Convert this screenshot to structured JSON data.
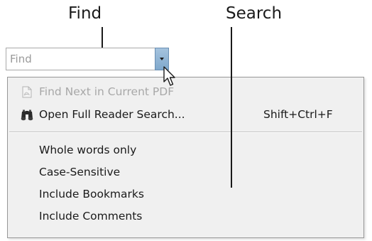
{
  "callouts": {
    "find": "Find",
    "search": "Search"
  },
  "find_box": {
    "placeholder": "Find",
    "value": ""
  },
  "menu": {
    "items": [
      {
        "label": "Find Next in Current PDF",
        "icon": "pdf-document-icon",
        "enabled": false
      },
      {
        "label": "Open Full Reader Search...",
        "icon": "binoculars-icon",
        "shortcut": "Shift+Ctrl+F",
        "enabled": true
      }
    ],
    "options": [
      {
        "label": "Whole words only"
      },
      {
        "label": "Case-Sensitive"
      },
      {
        "label": "Include Bookmarks"
      },
      {
        "label": "Include Comments"
      }
    ]
  }
}
